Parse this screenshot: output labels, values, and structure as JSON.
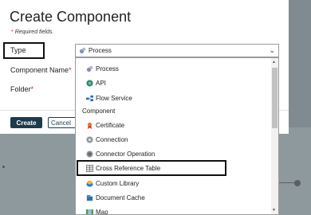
{
  "dialog": {
    "title": "Create Component",
    "required_note": "Required fields.",
    "required_star": "*",
    "fields": {
      "type_label": "Type",
      "component_name_label": "Component Name",
      "folder_label": "Folder"
    },
    "type_select": {
      "selected": "Process"
    },
    "buttons": {
      "create": "Create",
      "cancel": "Cancel"
    }
  },
  "dropdown": {
    "items_top": [
      "Process",
      "API",
      "Flow Service"
    ],
    "group_label": "Component",
    "items_component": [
      "Certificate",
      "Connection",
      "Connector Operation",
      "Cross Reference Table",
      "Custom Library",
      "Document Cache",
      "Map"
    ]
  }
}
